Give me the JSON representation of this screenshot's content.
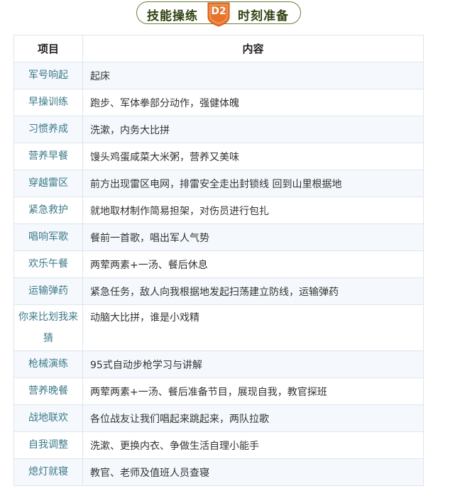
{
  "banner": {
    "left_text": "技能操练",
    "badge_text": "D2",
    "right_text": "时刻准备"
  },
  "colors": {
    "banner_text": "#2f4312",
    "badge": "#e8732a",
    "item_text": "#3d7a8a",
    "row_tint": "#f5f9fd"
  },
  "table": {
    "headers": [
      "项目",
      "内容"
    ],
    "rows": [
      {
        "item": "军号响起",
        "content": "起床"
      },
      {
        "item": "早操训练",
        "content": "跑步、军体拳部分动作，强健体魄"
      },
      {
        "item": "习惯养成",
        "content": "洗漱，内务大比拼"
      },
      {
        "item": "营养早餐",
        "content": "馒头鸡蛋咸菜大米粥，营养又美味"
      },
      {
        "item": "穿越雷区",
        "content": "前方出现雷区电网，排雷安全走出封锁线 回到山里根据地"
      },
      {
        "item": "紧急救护",
        "content": "就地取材制作简易担架，对伤员进行包扎"
      },
      {
        "item": "唱响军歌",
        "content": "餐前一首歌，唱出军人气势"
      },
      {
        "item": "欢乐午餐",
        "content": "两荤两素+一汤、餐后休息"
      },
      {
        "item": "运输弹药",
        "content": "紧急任务，敌人向我根据地发起扫荡建立防线，运输弹药"
      },
      {
        "item": "你来比划我来猜",
        "content": "动脑大比拼，谁是小戏精"
      },
      {
        "item": "枪械演练",
        "content": "95式自动步枪学习与讲解"
      },
      {
        "item": "营养晚餐",
        "content": "两荤两素+一汤、餐后准备节目，展现自我，教官探班"
      },
      {
        "item": "战地联欢",
        "content": "各位战友让我们唱起来跳起来，两队拉歌"
      },
      {
        "item": "自我调整",
        "content": "洗漱、更换内衣、争做生活自理小能手"
      },
      {
        "item": "熄灯就寝",
        "content": "教官、老师及值班人员查寝"
      }
    ]
  }
}
